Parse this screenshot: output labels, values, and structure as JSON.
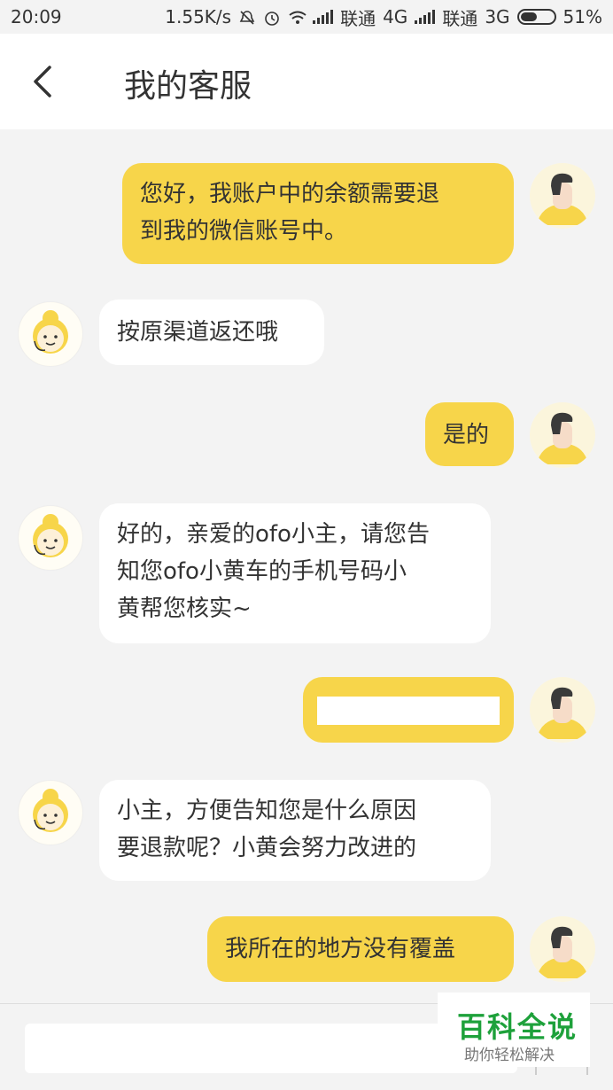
{
  "status_bar": {
    "time": "20:09",
    "net_speed": "1.55K/s",
    "carrier1": "联通",
    "network1": "4G",
    "carrier2": "联通",
    "network2": "3G",
    "battery": "51%",
    "battery_level": 0.51
  },
  "header": {
    "title": "我的客服",
    "back_icon": "chevron-left-icon"
  },
  "messages": [
    {
      "sender": "user",
      "text": "您好，我账户中的余额需要退到我的微信账号中。"
    },
    {
      "sender": "agent",
      "text": "按原渠道返还哦"
    },
    {
      "sender": "user",
      "text": "是的"
    },
    {
      "sender": "agent",
      "text": "好的，亲爱的ofo小主，请您告知您ofo小黄车的手机号码小黄帮您核实~"
    },
    {
      "sender": "user",
      "text": ""
    },
    {
      "sender": "agent",
      "text": "小主，方便告知您是什么原因要退款呢？小黄会努力改进的"
    },
    {
      "sender": "user",
      "text": "我所在的地方没有覆盖"
    }
  ],
  "message_lines": {
    "m1_l1": "您好，我账户中的余额需要退",
    "m1_l2": "到我的微信账号中。",
    "m4_l1": "好的，亲爱的ofo小主，请您告",
    "m4_l2": "知您ofo小黄车的手机号码小",
    "m4_l3": "黄帮您核实~",
    "m6_l1": "小主，方便告知您是什么原因",
    "m6_l2": "要退款呢？小黄会努力改进的"
  },
  "colors": {
    "user_bubble": "#f7d54a",
    "agent_bubble": "#ffffff",
    "background": "#f3f3f3"
  },
  "watermark": {
    "title": "百科全说",
    "subtitle": "助你轻松解决"
  }
}
